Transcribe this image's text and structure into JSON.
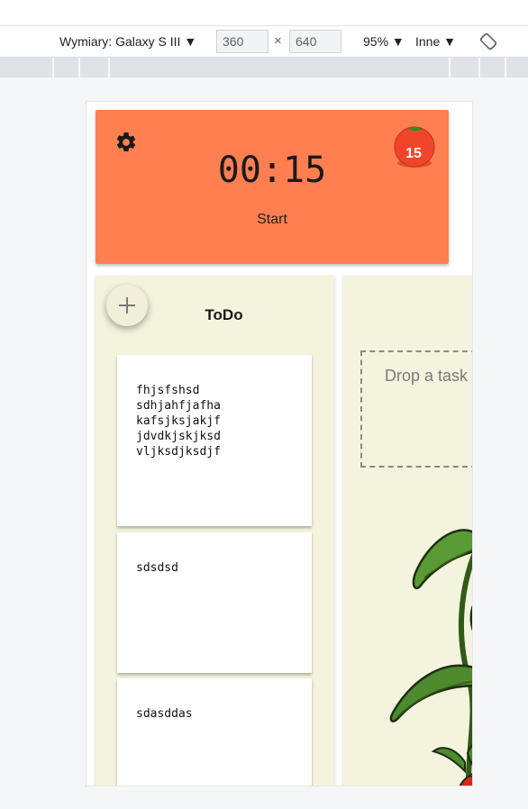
{
  "devtools": {
    "dimensions_label": "Wymiary: Galaxy S III",
    "dropdown_arrow": "▼",
    "width_value": "360",
    "height_value": "640",
    "times": "×",
    "zoom_label": "95%",
    "throttle_label": "Inne"
  },
  "timer": {
    "time": "00:15",
    "start_label": "Start",
    "tomato_count": "15",
    "background_color": "#ff7f50",
    "icons": [
      "gear-icon",
      "tomato-icon"
    ]
  },
  "todo": {
    "title": "ToDo",
    "add_icon": "plus-icon",
    "cards": [
      {
        "text": "fhjsfshsd\nsdhjahfjafha\nkafsjksjakjf\njdvdkjskjksd\nvljksdjksdjf"
      },
      {
        "text": "sdsdsd"
      },
      {
        "text": "sdasddas"
      }
    ]
  },
  "doing": {
    "drop_placeholder": "Drop a task"
  },
  "colors": {
    "column_bg": "#f4f3dd",
    "leaf_green": "#4e8a2e"
  }
}
